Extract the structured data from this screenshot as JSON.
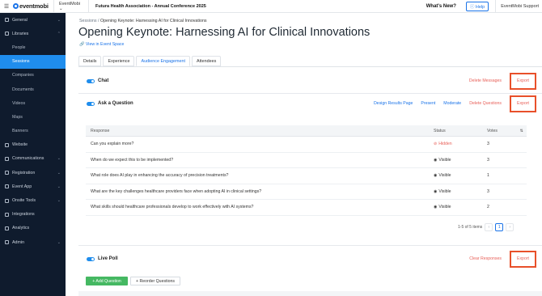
{
  "topbar": {
    "logo": "eventmobi",
    "org": "EventMobi",
    "event": "Futura Health Association - Annual Conference 2025",
    "whats_new": "What's New?",
    "help": "Help",
    "support": "EventMobi Support"
  },
  "sidebar": {
    "items": [
      {
        "label": "General",
        "icon": "globe-icon",
        "chevron": "⌄"
      },
      {
        "label": "Libraries",
        "icon": "library-icon",
        "chevron": "⌃"
      },
      {
        "label": "People"
      },
      {
        "label": "Sessions"
      },
      {
        "label": "Companies"
      },
      {
        "label": "Documents"
      },
      {
        "label": "Videos"
      },
      {
        "label": "Maps"
      },
      {
        "label": "Banners"
      },
      {
        "label": "Website",
        "icon": "monitor-icon"
      },
      {
        "label": "Communications",
        "icon": "chat-icon",
        "chevron": "⌄"
      },
      {
        "label": "Registration",
        "icon": "registration-icon",
        "chevron": "⌄"
      },
      {
        "label": "Event App",
        "icon": "app-icon",
        "chevron": "⌄"
      },
      {
        "label": "Onsite Tools",
        "icon": "tools-icon",
        "chevron": "⌄"
      },
      {
        "label": "Integrations",
        "icon": "integrations-icon"
      },
      {
        "label": "Analytics",
        "icon": "analytics-icon"
      },
      {
        "label": "Admin",
        "icon": "admin-icon",
        "chevron": "⌄"
      }
    ]
  },
  "breadcrumb": {
    "root": "Sessions",
    "sep": "/",
    "current": "Opening Keynote: Harnessing AI for Clinical Innovations"
  },
  "page_title": "Opening Keynote: Harnessing AI for Clinical Innovations",
  "view_link": "View in Event Space",
  "tabs": [
    "Details",
    "Experience",
    "Audience Engagement",
    "Attendees"
  ],
  "chat": {
    "label": "Chat",
    "delete": "Delete Messages",
    "export": "Export"
  },
  "qa": {
    "label": "Ask a Question",
    "design": "Design Results Page",
    "present": "Present",
    "moderate": "Moderate",
    "delete": "Delete Questions",
    "export": "Export"
  },
  "table": {
    "headers": [
      "Response",
      "Status",
      "Votes"
    ],
    "rows": [
      {
        "response": "Can you explain more?",
        "status": "Hidden",
        "votes": "3"
      },
      {
        "response": "When do we expect this to be implemented?",
        "status": "Visible",
        "votes": "3"
      },
      {
        "response": "What role does AI play in enhancing the accuracy of precision treatments?",
        "status": "Visible",
        "votes": "1"
      },
      {
        "response": "What are the key challenges healthcare providers face when adopting AI in clinical settings?",
        "status": "Visible",
        "votes": "3"
      },
      {
        "response": "What skills should healthcare professionals develop to work effectively with AI systems?",
        "status": "Visible",
        "votes": "2"
      }
    ]
  },
  "pager": {
    "summary": "1-5 of 5 items",
    "prev": "‹",
    "page": "1",
    "next": "›"
  },
  "poll": {
    "label": "Live Poll",
    "clear": "Clear Responses",
    "export": "Export",
    "add": "+ Add Question",
    "reorder": "Reorder Questions"
  },
  "colors": {
    "accent": "#1f8ded",
    "sidebar": "#0f1b2d",
    "danger": "#e8615a",
    "highlight": "#e8502a",
    "success": "#45b862"
  }
}
